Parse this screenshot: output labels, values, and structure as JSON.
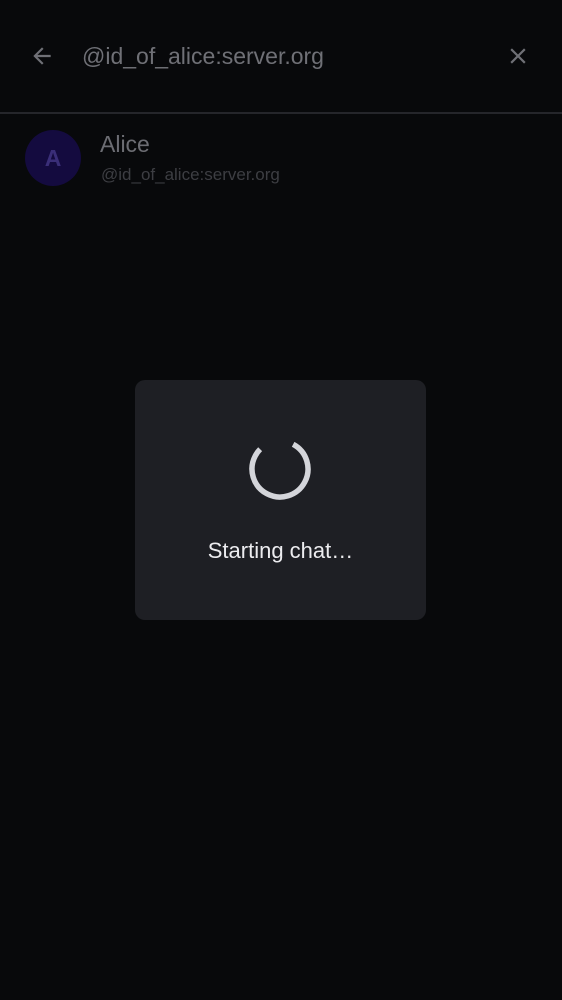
{
  "search": {
    "value": "@id_of_alice:server.org",
    "back_icon": "arrow-left-icon",
    "clear_icon": "close-icon"
  },
  "results": [
    {
      "avatar_initial": "A",
      "name": "Alice",
      "user_id": "@id_of_alice:server.org"
    }
  ],
  "dialog": {
    "message": "Starting chat…",
    "icon": "loading-spinner-icon"
  },
  "colors": {
    "background": "#08090b",
    "dialog_background": "#1e1f24",
    "avatar_background": "#140b3f",
    "avatar_initial": "#3a2e78"
  }
}
